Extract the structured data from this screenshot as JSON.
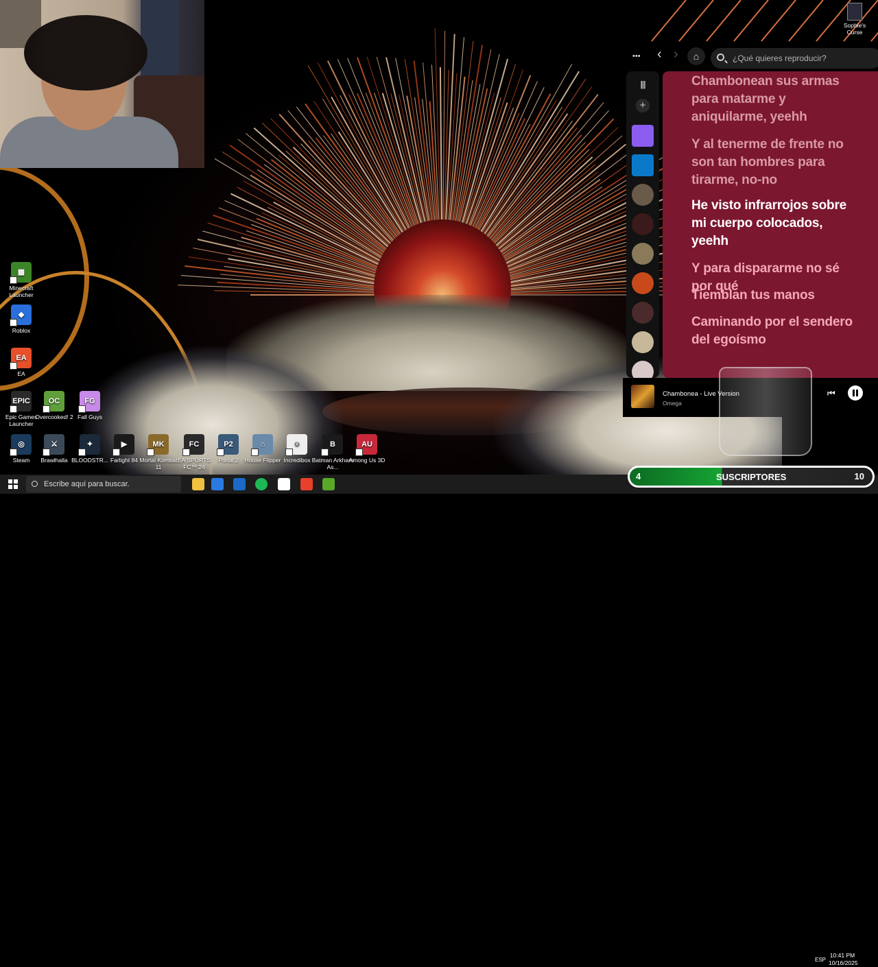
{
  "webcam": {
    "label": "streamer-webcam"
  },
  "desktop_icons": [
    {
      "label": "Minecraft Launcher",
      "color": "#3c8527",
      "glyph": "▦"
    },
    {
      "label": "Roblox",
      "color": "#2a6fdb",
      "glyph": "◆"
    },
    {
      "label": "EA",
      "color": "#e8502a",
      "glyph": "EA"
    },
    {
      "label": "Epic Games Launcher",
      "color": "#2a2a2a",
      "glyph": "EPIC"
    },
    {
      "label": "Overcooked! 2",
      "color": "#5fa03a",
      "glyph": "OC"
    },
    {
      "label": "Fall Guys",
      "color": "#c88ae8",
      "glyph": "FG"
    },
    {
      "label": "Steam",
      "color": "#1b3b5c",
      "glyph": "◎"
    },
    {
      "label": "Brawlhalla",
      "color": "#3a4a5a",
      "glyph": "⚔"
    },
    {
      "label": "BLOODSTR...",
      "color": "#1a2a3a",
      "glyph": "✦"
    },
    {
      "label": "Farlight 84",
      "color": "#1a1a1a",
      "glyph": "▶"
    },
    {
      "label": "Mortal Kombat 11",
      "color": "#8a6a2a",
      "glyph": "MK"
    },
    {
      "label": "EA SPORTS FC™ 24",
      "color": "#2a2a2a",
      "glyph": "FC"
    },
    {
      "label": "Portal 2",
      "color": "#3a5a7a",
      "glyph": "P2"
    },
    {
      "label": "House Flipper",
      "color": "#6a8aaa",
      "glyph": "⌂"
    },
    {
      "label": "Incredibox",
      "color": "#eeeeee",
      "glyph": "☺"
    },
    {
      "label": "Batman Arkham As...",
      "color": "#1a1a1a",
      "glyph": "B"
    },
    {
      "label": "Among Us 3D",
      "color": "#c8283a",
      "glyph": "AU"
    }
  ],
  "corner_icon": {
    "label": "Sophie's Curse"
  },
  "spotify": {
    "search_placeholder": "¿Qué quieres reproducir?",
    "more_glyph": "•••",
    "back_glyph": "‹",
    "forward_glyph": "›",
    "home_glyph": "⌂",
    "library_glyph": "|||",
    "add_glyph": "+",
    "lyrics": [
      {
        "text": "Chambonean sus armas para matarme y aniquilarme, yeehh",
        "state": "past"
      },
      {
        "text": "Y al tenerme de frente no son tan hombres para tirarme, no-no",
        "state": "past"
      },
      {
        "text": "He visto infrarrojos sobre mi cuerpo colocados, yeehh",
        "state": "now"
      },
      {
        "text": "Y para dispararme no sé por qué",
        "state": "next"
      },
      {
        "text": "Tiemblan tus manos",
        "state": "next"
      },
      {
        "text": "Caminando por el sendero del egoísmo",
        "state": "next"
      }
    ],
    "now_playing": {
      "track": "Chambonea - Live Version",
      "artist": "Omega"
    },
    "prev_glyph": "⏮",
    "sidebar_thumbs": [
      "#8a5cf0",
      "#0a7ac8",
      "#6a5a4a",
      "#3a1a1a",
      "#8a7a5a",
      "#c84a1a",
      "#4a2a2a",
      "#c8b89a",
      "#d8c8c8"
    ]
  },
  "taskbar": {
    "search_placeholder": "Escribe aquí para buscar.",
    "apps": [
      "#f0c040",
      "#2a7ae2",
      "#1a6ac8",
      "#1db954",
      "#ffffff",
      "#e8402a",
      "#5aa82a"
    ]
  },
  "subs_widget": {
    "count": "4",
    "label": "SUSCRIPTORES",
    "goal": "10"
  },
  "tray": {
    "lang": "ESP",
    "time": "10:41 PM",
    "date": "10/16/2025"
  }
}
